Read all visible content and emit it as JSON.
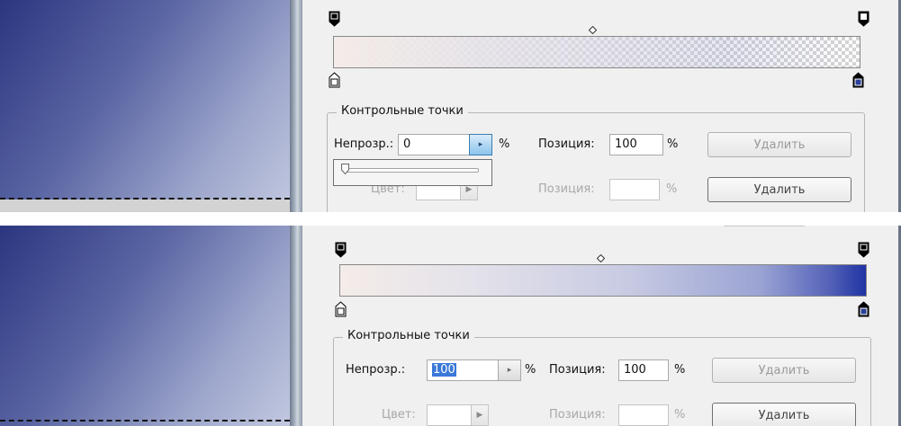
{
  "colors": {
    "canvas_dark": "#2c3680",
    "canvas_light": "#c2c8e0",
    "gradient_start": "#f4ece8",
    "gradient_end": "#2538a0",
    "stop_color_fill": "#2a3f9a",
    "dialog_bg": "#f0f0f0"
  },
  "top": {
    "group_title": "Контрольные точки",
    "opacity_label": "Непрозр.:",
    "opacity_value": "0",
    "opacity_unit": "%",
    "opacity_location_label": "Позиция:",
    "opacity_location_value": "100",
    "opacity_location_unit": "%",
    "opacity_delete": "Удалить",
    "color_label": "Цвет:",
    "color_location_label": "Позиция:",
    "color_location_value": "",
    "color_location_unit": "%",
    "color_delete": "Удалить",
    "slider_value": 0
  },
  "bottom": {
    "group_title": "Контрольные точки",
    "opacity_label": "Непрозр.:",
    "opacity_value": "100",
    "opacity_unit": "%",
    "opacity_location_label": "Позиция:",
    "opacity_location_value": "100",
    "opacity_location_unit": "%",
    "opacity_delete": "Удалить",
    "color_label": "Цвет:",
    "color_location_label": "Позиция:",
    "color_location_value": "",
    "color_location_unit": "%",
    "color_delete": "Удалить"
  },
  "icons": {
    "opacity_stop": "opacity-stop-icon",
    "color_stop": "color-stop-icon",
    "midpoint": "midpoint-diamond-icon",
    "spin_arrow": "triangle-right-icon",
    "slider_thumb": "slider-thumb-icon"
  }
}
